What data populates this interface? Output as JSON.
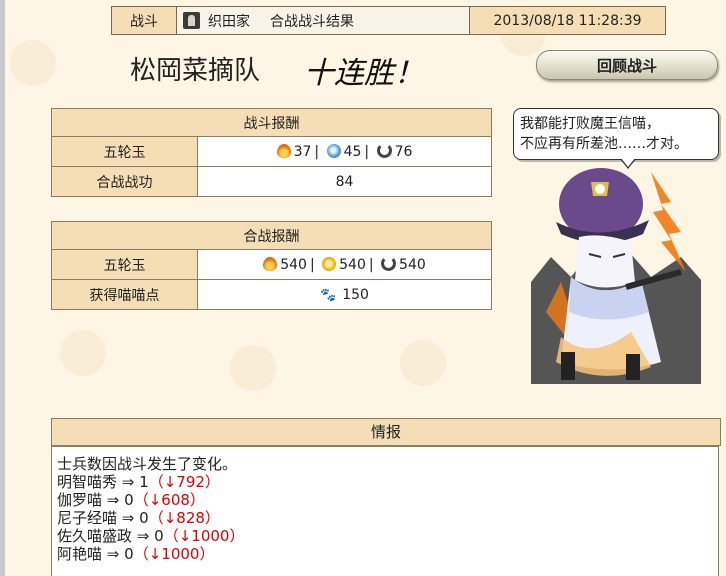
{
  "header": {
    "category": "战斗",
    "clan": "织田家",
    "title": "合战战斗结果",
    "datetime": "2013/08/18 11:28:39"
  },
  "squad": {
    "name": "松岡菜摘队",
    "streak": "十连胜！"
  },
  "review_button": {
    "label": "回顾战斗"
  },
  "battle_reward": {
    "title": "战斗报酬",
    "gem_label": "五轮玉",
    "gems": {
      "fire": "37",
      "water": "45",
      "moon": "76"
    },
    "merit_label": "合战战功",
    "merit_value": "84"
  },
  "war_reward": {
    "title": "合战报酬",
    "gem_label": "五轮玉",
    "gems": {
      "fire": "540",
      "wind": "540",
      "moon": "540"
    },
    "points_label": "获得喵喵点",
    "points_value": "150"
  },
  "speech": {
    "line1": "我都能打败魔王信喵，",
    "line2": "不应再有所差池……才对。"
  },
  "info": {
    "title": "情报",
    "intro": "士兵数因战斗发生了变化。",
    "rows": [
      {
        "name": "明智喵秀",
        "arrow": "⇒",
        "value": "1",
        "change": "（↓792）"
      },
      {
        "name": "伽罗喵",
        "arrow": "⇒",
        "value": "0",
        "change": "（↓608）"
      },
      {
        "name": "尼子经喵",
        "arrow": "⇒",
        "value": "0",
        "change": "（↓828）"
      },
      {
        "name": "佐久喵盛政",
        "arrow": "⇒",
        "value": "0",
        "change": "（↓1000）"
      },
      {
        "name": "阿艳喵",
        "arrow": "⇒",
        "value": "0",
        "change": "（↓1000）"
      }
    ]
  },
  "colors": {
    "panel_header": "#f5deb5",
    "background": "#fdf6e4",
    "loss": "#e00000",
    "border": "#8a7d60"
  }
}
